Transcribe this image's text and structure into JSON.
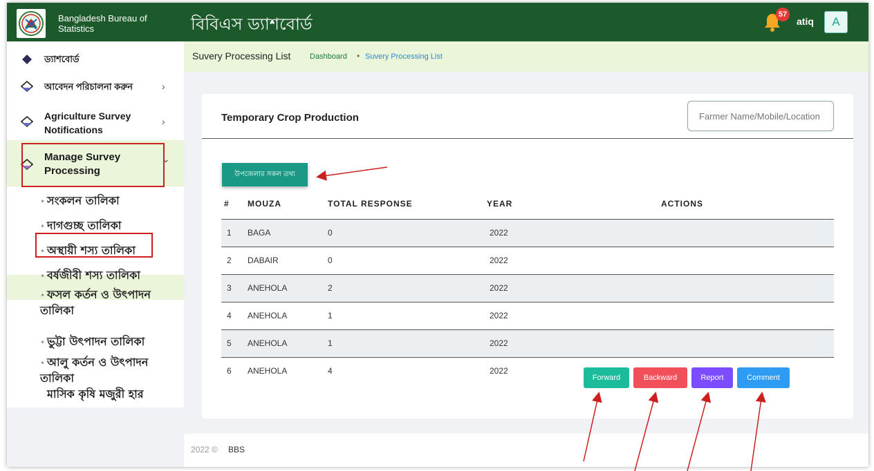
{
  "header": {
    "org_name": "Bangladesh Bureau of Statistics",
    "app_title": "বিবিএস ড্যাশবোর্ড",
    "notification_count": "57",
    "username": "atiq",
    "avatar_letter": "A"
  },
  "sidebar": {
    "items": [
      {
        "label": "ড্যাশবোর্ড"
      },
      {
        "label": "আবেদন পরিচালনা করুন",
        "chevron": "›"
      },
      {
        "label": "Agriculture Survey Notifications",
        "chevron": "›"
      },
      {
        "label": "Manage Survey Processing",
        "chevron": "⌄"
      }
    ],
    "sub_items": [
      "সংকলন তালিকা",
      "দাগগুচ্ছ তালিকা",
      "অস্থায়ী শস্য তালিকা",
      "বর্ষজীবী শস্য তালিকা",
      "ফসল কর্তন ও উৎপাদন তালিকা",
      "ভুট্টা উৎপাদন তালিকা",
      "আলু কর্তন ও উৎপাদন তালিকা",
      "মাসিক কৃষি মজুরী হার"
    ],
    "bullet": "•"
  },
  "breadcrumb": {
    "page_name": "Suvery Processing List",
    "home": "Dashboard",
    "separator": "•",
    "current": "Suvery Processing List"
  },
  "card": {
    "title": "Temporary Crop Production",
    "search_placeholder": "Farmer Name/Mobile/Location",
    "upazila_button": "উপজেলার সকল তথ্য"
  },
  "table": {
    "headers": [
      "#",
      "MOUZA",
      "TOTAL RESPONSE",
      "YEAR",
      "ACTIONS"
    ],
    "rows": [
      {
        "no": "1",
        "mouza": "BAGA",
        "total": "0",
        "year": "2022"
      },
      {
        "no": "2",
        "mouza": "DABAIR",
        "total": "0",
        "year": "2022"
      },
      {
        "no": "3",
        "mouza": "ANEHOLA",
        "total": "2",
        "year": "2022"
      },
      {
        "no": "4",
        "mouza": "ANEHOLA",
        "total": "1",
        "year": "2022"
      },
      {
        "no": "5",
        "mouza": "ANEHOLA",
        "total": "1",
        "year": "2022"
      },
      {
        "no": "6",
        "mouza": "ANEHOLA",
        "total": "4",
        "year": "2022"
      }
    ],
    "actions": [
      {
        "label": "Forward",
        "color": "#1abc9c"
      },
      {
        "label": "Backward",
        "color": "#f1505a"
      },
      {
        "label": "Report",
        "color": "#7c4dff"
      },
      {
        "label": "Comment",
        "color": "#2d9cf2"
      }
    ]
  },
  "footer": {
    "year": "2022 ©",
    "org": "BBS"
  },
  "colors": {
    "header_bg": "#1d5a2b",
    "highlight_bg": "#eaf5d9",
    "annotation_red": "#cc1f1f"
  }
}
